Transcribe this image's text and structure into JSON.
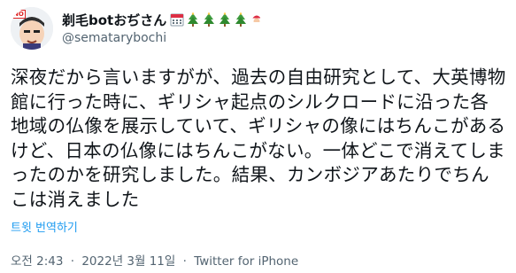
{
  "user": {
    "display_name": "剃毛botおぢさん",
    "handle": "@sematarybochi",
    "name_emojis": [
      "calendar-icon",
      "tree-icon",
      "tree-icon",
      "tree-icon",
      "tree-icon",
      "santa-icon"
    ],
    "avatar_badge": "NO"
  },
  "tweet": {
    "text": "深夜だから言いますがが、過去の自由研究として、大英博物館に行った時に、ギリシャ起点のシルクロードに沿った各地域の仏像を展示していて、ギリシャの像にはちんこがあるけど、日本の仏像にはちんこがない。一体どこで消えてしまったのかを研究しました。結果、カンボジアあたりでちんこは消えました",
    "translate_label": "트윗 번역하기"
  },
  "meta": {
    "time": "오전 2:43",
    "date": "2022년 3월 11일",
    "separator": "·",
    "source": "Twitter for iPhone"
  },
  "colors": {
    "text": "#0f1419",
    "secondary": "#536471",
    "link": "#1d9bf0"
  }
}
